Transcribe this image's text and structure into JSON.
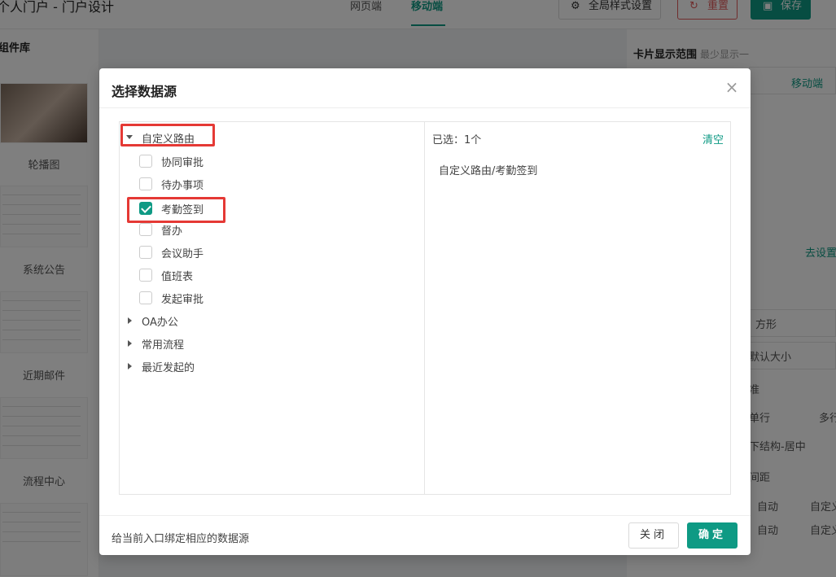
{
  "app": {
    "title": "个人门户 - 门户设计",
    "tabs": [
      {
        "label": "网页端"
      },
      {
        "label": "移动端"
      }
    ],
    "global_style_label": "全局样式设置",
    "reset_label": "重置",
    "save_label": "保存"
  },
  "left_panel": {
    "title": "组件库",
    "cards": [
      {
        "label": "轮播图"
      },
      {
        "label": "系统公告"
      },
      {
        "label": "近期邮件"
      },
      {
        "label": "流程中心"
      }
    ]
  },
  "right_panel": {
    "title": "卡片显示范围",
    "subtitle": "最少显示一",
    "mobile_label": "移动端",
    "go_settings": "去设置",
    "shape": "方形",
    "size": "默认大小",
    "standard": "准",
    "single_line": "单行",
    "multi_line": "多行",
    "layout": "下结构-居中",
    "spacing": "间距",
    "auto": "自动",
    "custom": "自定义"
  },
  "dialog": {
    "title": "选择数据源",
    "tree": [
      {
        "label": "自定义路由",
        "expanded": true,
        "children": [
          {
            "label": "协同审批",
            "checked": false
          },
          {
            "label": "待办事项",
            "checked": false
          },
          {
            "label": "考勤签到",
            "checked": true
          },
          {
            "label": "督办",
            "checked": false
          },
          {
            "label": "会议助手",
            "checked": false
          },
          {
            "label": "值班表",
            "checked": false
          },
          {
            "label": "发起审批",
            "checked": false
          }
        ]
      },
      {
        "label": "OA办公",
        "expanded": false
      },
      {
        "label": "常用流程",
        "expanded": false
      },
      {
        "label": "最近发起的",
        "expanded": false
      }
    ],
    "selected_count_label": "已选：1个",
    "clear_label": "清空",
    "selected_items": [
      "自定义路由/考勤签到"
    ],
    "footer_hint": "给当前入口绑定相应的数据源",
    "close_button": "关闭",
    "ok_button": "确定"
  },
  "colors": {
    "accent": "#0e9a84",
    "highlight": "#e53935"
  }
}
